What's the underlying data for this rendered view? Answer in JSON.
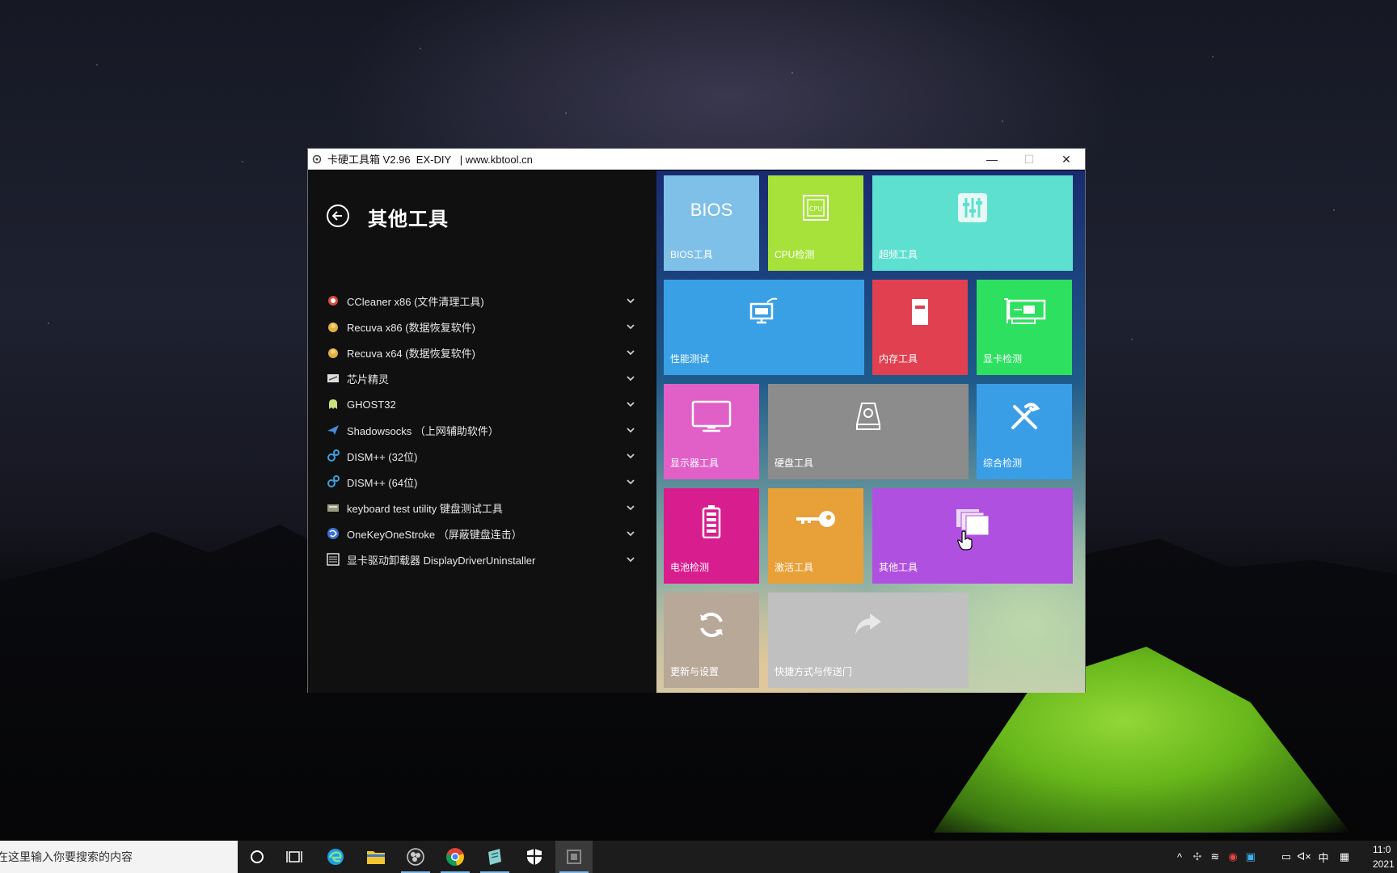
{
  "window": {
    "title": "卡硬工具箱 V2.96  EX-DIY   | www.kbtool.cn",
    "minimize": "—",
    "maximize": "☐",
    "close": "✕"
  },
  "left_panel": {
    "title": "其他工具",
    "items": [
      {
        "label": "CCleaner x86 (文件清理工具)",
        "icon": "ccleaner-icon",
        "color": "#d84a3a"
      },
      {
        "label": "Recuva x86 (数据恢复软件)",
        "icon": "recuva-icon",
        "color": "#e0b040"
      },
      {
        "label": "Recuva x64 (数据恢复软件)",
        "icon": "recuva-icon",
        "color": "#e0b040"
      },
      {
        "label": "芯片精灵",
        "icon": "chip-icon",
        "color": "#dddddd"
      },
      {
        "label": "GHOST32",
        "icon": "ghost-icon",
        "color": "#c8e080"
      },
      {
        "label": "Shadowsocks （上网辅助软件）",
        "icon": "paper-plane-icon",
        "color": "#4a8ad8"
      },
      {
        "label": "DISM++ (32位)",
        "icon": "gears-icon",
        "color": "#3aa0e0"
      },
      {
        "label": "DISM++ (64位)",
        "icon": "gears-icon",
        "color": "#3aa0e0"
      },
      {
        "label": "keyboard test utility 键盘测试工具",
        "icon": "keyboard-icon",
        "color": "#c0c0a0"
      },
      {
        "label": "OneKeyOneStroke （屏蔽键盘连击）",
        "icon": "globe-icon",
        "color": "#3a70d0"
      },
      {
        "label": "显卡驱动卸载器 DisplayDriverUninstaller",
        "icon": "ddu-icon",
        "color": "#dddddd"
      }
    ]
  },
  "tiles": [
    {
      "id": "bios",
      "label": "BIOS工具",
      "icon_text": "BIOS",
      "color": "#7ec0e8"
    },
    {
      "id": "cpu",
      "label": "CPU检测",
      "icon_text": "CPU",
      "color": "#a6e23a"
    },
    {
      "id": "overclock",
      "label": "超频工具",
      "color": "#5ee0d0"
    },
    {
      "id": "perf",
      "label": "性能测试",
      "color": "#3aa0e6"
    },
    {
      "id": "memory",
      "label": "内存工具",
      "color": "#e04050"
    },
    {
      "id": "gpu",
      "label": "显卡检测",
      "color": "#2ee060"
    },
    {
      "id": "monitor",
      "label": "显示器工具",
      "color": "#e060c8"
    },
    {
      "id": "disk",
      "label": "硬盘工具",
      "color": "#8c8c8c"
    },
    {
      "id": "overall",
      "label": "综合检测",
      "color": "#3a9ee6"
    },
    {
      "id": "battery",
      "label": "电池检测",
      "color": "#d81e8e"
    },
    {
      "id": "activate",
      "label": "激活工具",
      "color": "#e8a038"
    },
    {
      "id": "other",
      "label": "其他工具",
      "color": "#b050e0"
    },
    {
      "id": "update",
      "label": "更新与设置",
      "color": "#b8a898"
    },
    {
      "id": "shortcut",
      "label": "快捷方式与传送门",
      "color": "#c0c0c0"
    }
  ],
  "taskbar": {
    "search_placeholder": "在这里输入你要搜索的内容",
    "ime": "中",
    "time": "11:0",
    "date": "2021"
  }
}
